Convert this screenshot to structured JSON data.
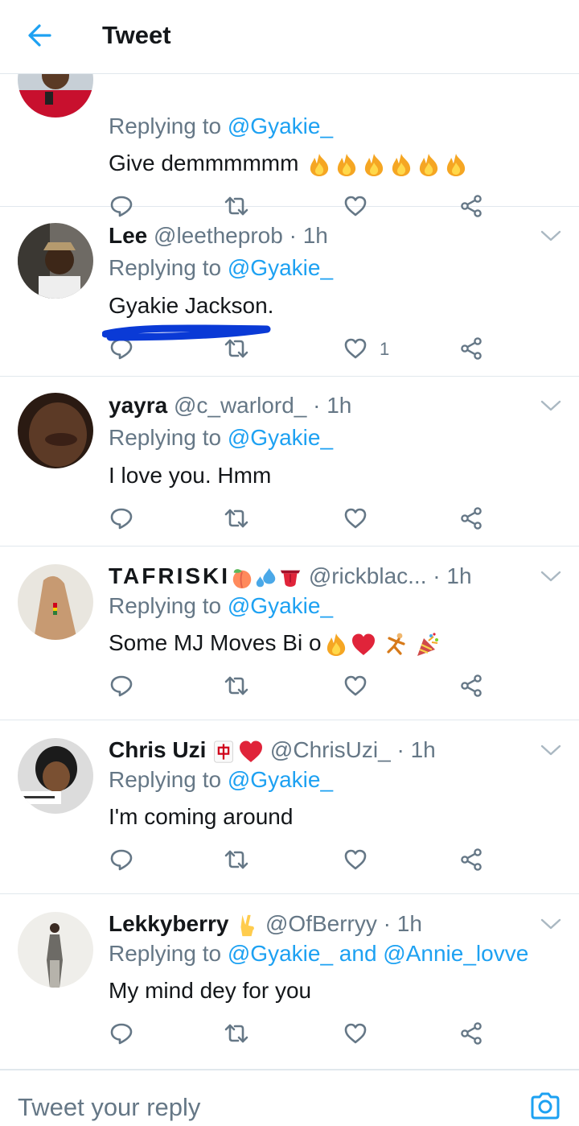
{
  "header": {
    "title": "Tweet"
  },
  "tweets": [
    {
      "reply_prefix": "Replying to ",
      "reply_mention": "@Gyakie_",
      "text": "Give demmmmmm",
      "emojis": [
        "fire",
        "fire",
        "fire",
        "fire",
        "fire",
        "fire"
      ],
      "like_count": ""
    },
    {
      "name": "Lee",
      "handle": "@leetheprob",
      "sep": " · ",
      "time": "1h",
      "reply_prefix": "Replying to ",
      "reply_mention": "@Gyakie_",
      "text": "Gyakie Jackson.",
      "like_count": "1"
    },
    {
      "name": "yayra",
      "handle": "@c_warlord_",
      "sep": " · ",
      "time": "1h",
      "reply_prefix": "Replying to ",
      "reply_mention": "@Gyakie_",
      "text": "I love you. Hmm",
      "like_count": ""
    },
    {
      "name": "TAFRISKI",
      "name_emojis": [
        "peach",
        "sweat-droplets",
        "tongue"
      ],
      "handle": "@rickblac...",
      "sep": " · ",
      "time": "1h",
      "reply_prefix": "Replying to ",
      "reply_mention": "@Gyakie_",
      "text": "Some MJ Moves Bi o",
      "emojis": [
        "fire",
        "red-heart",
        "dancing-figure",
        "party-popper"
      ],
      "like_count": ""
    },
    {
      "name": "Chris Uzi",
      "name_emojis": [
        "mahjong-red-dragon",
        "red-heart"
      ],
      "handle": "@ChrisUzi_",
      "sep": " · ",
      "time": "1h",
      "reply_prefix": "Replying to ",
      "reply_mention": "@Gyakie_",
      "text": "I'm coming around",
      "like_count": ""
    },
    {
      "name": "Lekkyberry",
      "name_emojis": [
        "victory-hand"
      ],
      "handle": "@OfBerryy",
      "sep": " · ",
      "time": "1h",
      "reply_prefix": "Replying to ",
      "reply_mention": "@Gyakie_",
      "reply_and": " and ",
      "reply_mention2": "@Annie_lovve",
      "text": "My mind dey for you",
      "like_count": ""
    }
  ],
  "composer": {
    "placeholder": "Tweet your reply"
  },
  "colors": {
    "accent": "#1da1f2",
    "secondary_text": "#657786",
    "primary_text": "#14171a",
    "divider": "#e1e8ed",
    "redaction": "#0a3ad6"
  }
}
